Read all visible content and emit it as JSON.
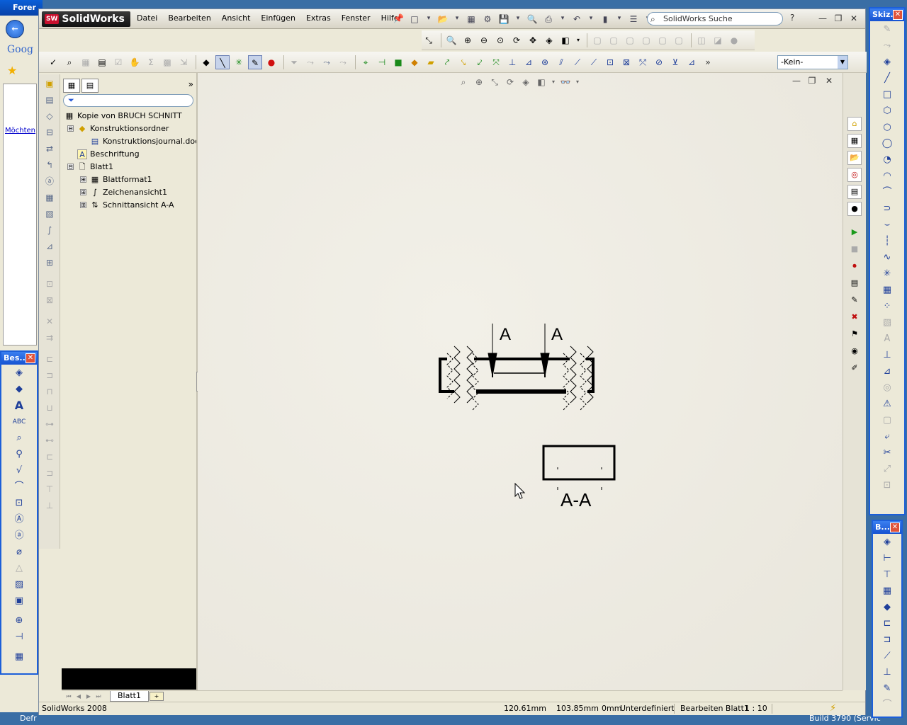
{
  "browser": {
    "title": "Forer",
    "search_logo": "Goog",
    "link": "Möchten"
  },
  "taskbar": {
    "left_text": "Defr",
    "right_text": "Build 3790 (Servic"
  },
  "app": {
    "logo": "SolidWorks",
    "logo_badge": "SW",
    "menu": [
      "Datei",
      "Bearbeiten",
      "Ansicht",
      "Einfügen",
      "Extras",
      "Fenster",
      "Hilfe"
    ],
    "search_placeholder": "SolidWorks Suche",
    "help": "?"
  },
  "toolbar": {
    "layer_value": "-Kein-"
  },
  "feature_tree": {
    "root": "Kopie von BRUCH SCHNITT",
    "items": [
      {
        "label": "Konstruktionsordner",
        "level": 1,
        "expander": "⊟"
      },
      {
        "label": "Konstruktionsjournal.doc",
        "level": 2,
        "expander": ""
      },
      {
        "label": "Beschriftung",
        "level": 1,
        "expander": ""
      },
      {
        "label": "Blatt1",
        "level": 1,
        "expander": "⊟"
      },
      {
        "label": "Blattformat1",
        "level": 2,
        "expander": "⊞"
      },
      {
        "label": "Zeichenansicht1",
        "level": 2,
        "expander": "⊞"
      },
      {
        "label": "Schnittansicht A-A",
        "level": 2,
        "expander": "⊞"
      }
    ]
  },
  "drawing": {
    "section_letter_left": "A",
    "section_letter_right": "A",
    "section_view_label": "A-A"
  },
  "sheet_tabs": {
    "active": "Blatt1"
  },
  "status": {
    "app_name": "SolidWorks 2008",
    "x": "120.61mm",
    "y": "103.85mm",
    "z": "0mm",
    "state": "Unterdefiniert",
    "mode": "Bearbeiten Blatt1",
    "scale": "1 : 10"
  },
  "palettes": {
    "annotation_title": "Bes...",
    "sketch_title": "Skiz...",
    "dimension_title": "B..."
  },
  "colors": {
    "accent": "#1c5fd9",
    "canvas": "#efede5",
    "title_bar": "#0a5fd8"
  }
}
